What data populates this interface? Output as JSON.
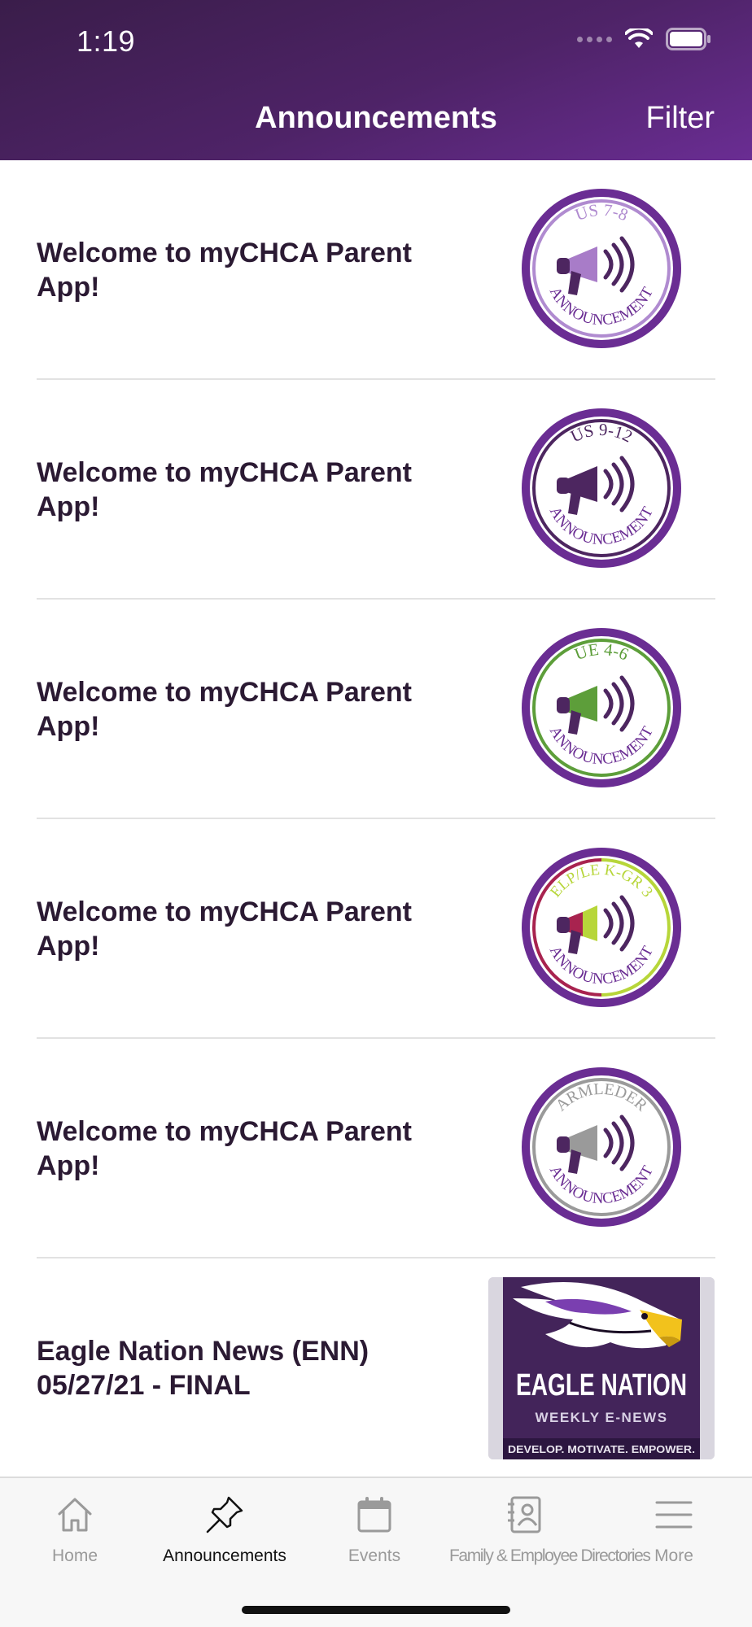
{
  "status": {
    "time": "1:19"
  },
  "nav": {
    "title": "Announcements",
    "filter": "Filter"
  },
  "announcements": [
    {
      "title": "Welcome to myCHCA Parent App!",
      "badge": {
        "top": "US 7-8",
        "bottom": "ANNOUNCEMENT",
        "ring": "#b08bd0",
        "megaphone": "#a87cc8"
      }
    },
    {
      "title": "Welcome to myCHCA Parent App!",
      "badge": {
        "top": "US 9-12",
        "bottom": "ANNOUNCEMENT",
        "ring": "#4d2660",
        "megaphone": "#4d2660"
      }
    },
    {
      "title": "Welcome to myCHCA Parent App!",
      "badge": {
        "top": "UE 4-6",
        "bottom": "ANNOUNCEMENT",
        "ring": "#5d9e3a",
        "megaphone": "#5d9e3a"
      }
    },
    {
      "title": "Welcome to myCHCA Parent App!",
      "badge": {
        "top": "ELP/LE K-GR 3",
        "bottom": "ANNOUNCEMENT",
        "ring": "#b7d63a",
        "ring2": "#a8234f",
        "megaphone": "#b7d63a"
      }
    },
    {
      "title": "Welcome to myCHCA Parent App!",
      "badge": {
        "top": "ARMLEDER",
        "bottom": "ANNOUNCEMENT",
        "ring": "#9a9a9a",
        "megaphone": "#9a9a9a"
      }
    },
    {
      "title": "Eagle Nation News (ENN) 05/27/21 - FINAL",
      "image": {
        "headline": "EAGLE NATION",
        "sub": "WEEKLY E-NEWS",
        "tagline": "DEVELOP. MOTIVATE. EMPOWER."
      }
    }
  ],
  "tabs": [
    {
      "label": "Home",
      "icon": "home-icon"
    },
    {
      "label": "Announcements",
      "icon": "pushpin-icon",
      "active": true
    },
    {
      "label": "Events",
      "icon": "calendar-icon"
    },
    {
      "label": "Family & Employee Directories",
      "icon": "contact-book-icon"
    },
    {
      "label": "More",
      "icon": "menu-icon"
    }
  ],
  "colors": {
    "brand_purple": "#6a2d93",
    "badge_border": "#6a2d93",
    "title_text": "#2b1a33"
  }
}
